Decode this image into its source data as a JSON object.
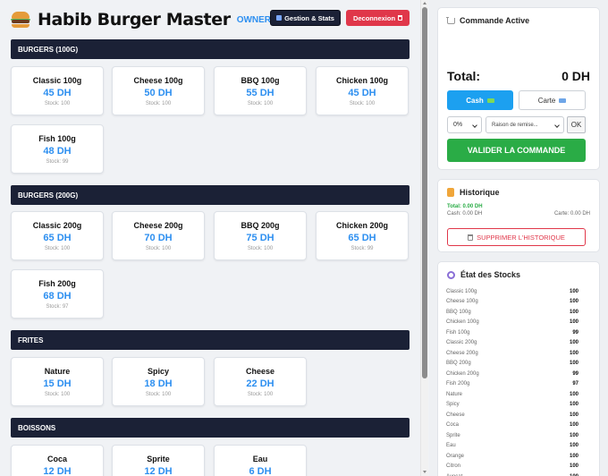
{
  "header": {
    "title": "Habib Burger Master",
    "role": "OWNER (owner)",
    "gestion_label": "Gestion & Stats",
    "logout_label": "Deconnexion"
  },
  "sections": [
    {
      "title": "BURGERS (100G)",
      "items": [
        {
          "name": "Classic 100g",
          "price": "45 DH",
          "stock": "Stock: 100"
        },
        {
          "name": "Cheese 100g",
          "price": "50 DH",
          "stock": "Stock: 100"
        },
        {
          "name": "BBQ 100g",
          "price": "55 DH",
          "stock": "Stock: 100"
        },
        {
          "name": "Chicken 100g",
          "price": "45 DH",
          "stock": "Stock: 100"
        },
        {
          "name": "Fish 100g",
          "price": "48 DH",
          "stock": "Stock: 99"
        }
      ]
    },
    {
      "title": "BURGERS (200G)",
      "items": [
        {
          "name": "Classic 200g",
          "price": "65 DH",
          "stock": "Stock: 100"
        },
        {
          "name": "Cheese 200g",
          "price": "70 DH",
          "stock": "Stock: 100"
        },
        {
          "name": "BBQ 200g",
          "price": "75 DH",
          "stock": "Stock: 100"
        },
        {
          "name": "Chicken 200g",
          "price": "65 DH",
          "stock": "Stock: 99"
        },
        {
          "name": "Fish 200g",
          "price": "68 DH",
          "stock": "Stock: 97"
        }
      ]
    },
    {
      "title": "FRITES",
      "items": [
        {
          "name": "Nature",
          "price": "15 DH",
          "stock": "Stock: 100"
        },
        {
          "name": "Spicy",
          "price": "18 DH",
          "stock": "Stock: 100"
        },
        {
          "name": "Cheese",
          "price": "22 DH",
          "stock": "Stock: 100"
        }
      ]
    },
    {
      "title": "BOISSONS",
      "items": [
        {
          "name": "Coca",
          "price": "12 DH",
          "stock": ""
        },
        {
          "name": "Sprite",
          "price": "12 DH",
          "stock": ""
        },
        {
          "name": "Eau",
          "price": "6 DH",
          "stock": ""
        }
      ]
    }
  ],
  "order": {
    "title": "Commande Active",
    "total_label": "Total:",
    "total_value": "0 DH",
    "cash_label": "Cash",
    "card_label": "Carte",
    "discount_value": "0%",
    "reason_placeholder": "Raison de remise...",
    "ok_label": "OK",
    "validate_label": "VALIDER LA COMMANDE"
  },
  "history": {
    "title": "Historique",
    "total": "Total: 0.00 DH",
    "cash": "Cash: 0.00 DH",
    "card": "Carte: 0.00 DH",
    "delete_label": "SUPPRIMER L'HISTORIQUE"
  },
  "stocks": {
    "title": "État des Stocks",
    "rows": [
      {
        "name": "Classic 100g",
        "qty": "100"
      },
      {
        "name": "Cheese 100g",
        "qty": "100"
      },
      {
        "name": "BBQ 100g",
        "qty": "100"
      },
      {
        "name": "Chicken 100g",
        "qty": "100"
      },
      {
        "name": "Fish 100g",
        "qty": "99"
      },
      {
        "name": "Classic 200g",
        "qty": "100"
      },
      {
        "name": "Cheese 200g",
        "qty": "100"
      },
      {
        "name": "BBQ 200g",
        "qty": "100"
      },
      {
        "name": "Chicken 200g",
        "qty": "99"
      },
      {
        "name": "Fish 200g",
        "qty": "97"
      },
      {
        "name": "Nature",
        "qty": "100"
      },
      {
        "name": "Spicy",
        "qty": "100"
      },
      {
        "name": "Cheese",
        "qty": "100"
      },
      {
        "name": "Coca",
        "qty": "100"
      },
      {
        "name": "Sprite",
        "qty": "100"
      },
      {
        "name": "Eau",
        "qty": "100"
      },
      {
        "name": "Orange",
        "qty": "100"
      },
      {
        "name": "Citron",
        "qty": "100"
      },
      {
        "name": "Avocat",
        "qty": "100"
      }
    ]
  },
  "colors": {
    "accent": "#2d8ff0",
    "navy": "#1b2136",
    "danger": "#e0374a",
    "success": "#2aac46"
  }
}
